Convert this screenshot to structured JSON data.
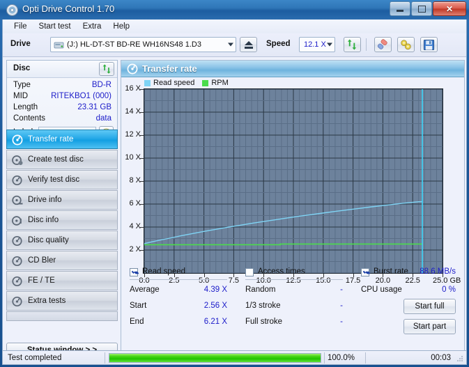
{
  "window": {
    "title": "Opti Drive Control 1.70",
    "icon": "disc-icon",
    "controls": {
      "minimize": "minimize-icon",
      "maximize": "maximize-icon",
      "close": "close-icon"
    }
  },
  "menu": {
    "items": [
      "File",
      "Start test",
      "Extra",
      "Help"
    ]
  },
  "drivebar": {
    "drive_label": "Drive",
    "drive_value": "(J:)  HL-DT-ST BD-RE  WH16NS48 1.D3",
    "eject_icon": "eject-icon",
    "speed_label": "Speed",
    "speed_value": "12.1 X",
    "tools": [
      "refresh-icon",
      "eraser-icon",
      "settings-icon",
      "save-icon"
    ]
  },
  "disc": {
    "header": "Disc",
    "refresh_icon": "refresh-icon",
    "rows": [
      {
        "key": "Type",
        "value": "BD-R"
      },
      {
        "key": "MID",
        "value": "RITEKBO1 (000)"
      },
      {
        "key": "Length",
        "value": "23.31 GB"
      },
      {
        "key": "Contents",
        "value": "data"
      }
    ],
    "label_key": "Label",
    "label_value": "",
    "label_placeholder": "",
    "label_icon": "disc-yellow-icon"
  },
  "sidebar": {
    "items": [
      {
        "label": "Transfer rate",
        "icon": "transfer-rate-icon",
        "selected": true
      },
      {
        "label": "Create test disc",
        "icon": "create-disc-icon",
        "selected": false
      },
      {
        "label": "Verify test disc",
        "icon": "verify-disc-icon",
        "selected": false
      },
      {
        "label": "Drive info",
        "icon": "drive-info-icon",
        "selected": false
      },
      {
        "label": "Disc info",
        "icon": "disc-info-icon",
        "selected": false
      },
      {
        "label": "Disc quality",
        "icon": "disc-quality-icon",
        "selected": false
      },
      {
        "label": "CD Bler",
        "icon": "cd-bler-icon",
        "selected": false
      },
      {
        "label": "FE / TE",
        "icon": "fe-te-icon",
        "selected": false
      },
      {
        "label": "Extra tests",
        "icon": "extra-tests-icon",
        "selected": false
      }
    ],
    "status_window_button": "Status window > >"
  },
  "main": {
    "header": "Transfer rate",
    "header_icon": "transfer-rate-icon"
  },
  "chart_data": {
    "type": "line",
    "title": "Transfer rate",
    "xlabel": "GB",
    "ylabel": "X",
    "xlim": [
      0.0,
      25.0
    ],
    "ylim": [
      0.0,
      16.0
    ],
    "xticks": [
      "0.0",
      "2.5",
      "5.0",
      "7.5",
      "10.0",
      "12.5",
      "15.0",
      "17.5",
      "20.0",
      "22.5",
      "25.0"
    ],
    "xtick_values": [
      0.0,
      2.5,
      5.0,
      7.5,
      10.0,
      12.5,
      15.0,
      17.5,
      20.0,
      22.5,
      25.0
    ],
    "xunit": "GB",
    "yticks": [
      "2 X",
      "4 X",
      "6 X",
      "8 X",
      "10 X",
      "12 X",
      "14 X",
      "16 X"
    ],
    "ytick_values": [
      2,
      4,
      6,
      8,
      10,
      12,
      14,
      16
    ],
    "grid": true,
    "legend_position": "top-left",
    "plot_background": "#6d829c",
    "cursor_x": 23.31,
    "series": [
      {
        "name": "Read speed",
        "color": "#7fd4f5",
        "x": [
          0.0,
          0.6,
          1.2,
          2.0,
          3.0,
          4.0,
          5.0,
          6.0,
          7.0,
          8.0,
          9.0,
          10.0,
          11.0,
          12.0,
          13.0,
          14.0,
          15.0,
          16.0,
          17.0,
          18.0,
          19.0,
          20.0,
          21.0,
          22.0,
          23.0,
          23.31
        ],
        "values": [
          2.56,
          2.7,
          2.84,
          3.0,
          3.22,
          3.42,
          3.62,
          3.8,
          3.98,
          4.15,
          4.32,
          4.48,
          4.63,
          4.79,
          4.94,
          5.08,
          5.22,
          5.36,
          5.49,
          5.62,
          5.75,
          5.87,
          5.99,
          6.1,
          6.2,
          6.21
        ]
      },
      {
        "name": "RPM",
        "color": "#4bdc4b",
        "x": [
          0.0,
          11.4,
          11.4,
          23.31
        ],
        "values": [
          2.46,
          2.46,
          2.52,
          2.52
        ]
      }
    ]
  },
  "results": {
    "read_speed": {
      "label": "Read speed",
      "checked": true,
      "rows": [
        {
          "key": "Average",
          "value": "4.39 X"
        },
        {
          "key": "Start",
          "value": "2.56 X"
        },
        {
          "key": "End",
          "value": "6.21 X"
        }
      ]
    },
    "access_times": {
      "label": "Access times",
      "checked": false,
      "rows": [
        {
          "key": "Random",
          "value": "-"
        },
        {
          "key": "1/3 stroke",
          "value": "-"
        },
        {
          "key": "Full stroke",
          "value": "-"
        }
      ]
    },
    "burst": {
      "label": "Burst rate",
      "checked": true,
      "value": "88.6 MB/s",
      "cpu_key": "CPU usage",
      "cpu_value": "0 %"
    },
    "buttons": [
      {
        "label": "Start full"
      },
      {
        "label": "Start part"
      }
    ]
  },
  "statusbar": {
    "text": "Test completed",
    "percent": "100.0%",
    "progress": 100,
    "time": "00:03"
  }
}
